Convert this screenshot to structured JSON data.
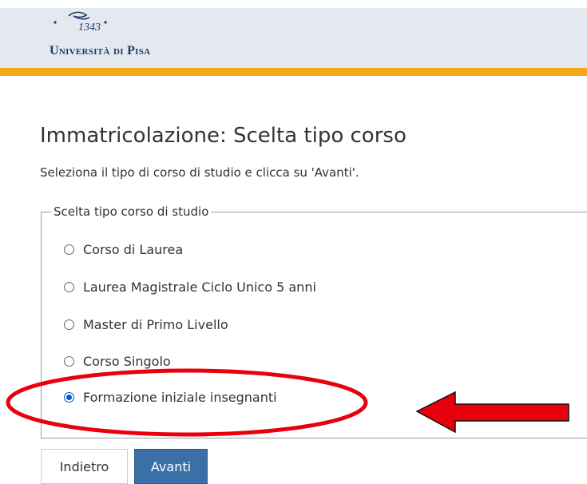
{
  "header": {
    "logo_year": "1343",
    "logo_text": "Università di Pisa",
    "bar_color": "#f6a919",
    "background_color": "#e3e9ee"
  },
  "main": {
    "title": "Immatricolazione: Scelta tipo corso",
    "instruction": "Seleziona il tipo di corso di studio e clicca su 'Avanti'.",
    "fieldset_legend": "Scelta tipo corso di studio",
    "options": [
      {
        "label": "Corso di Laurea",
        "checked": false
      },
      {
        "label": "Laurea Magistrale Ciclo Unico 5 anni",
        "checked": false
      },
      {
        "label": "Master di Primo Livello",
        "checked": false
      },
      {
        "label": "Corso Singolo",
        "checked": false
      },
      {
        "label": "Formazione iniziale insegnanti",
        "checked": true
      }
    ]
  },
  "buttons": {
    "back_label": "Indietro",
    "next_label": "Avanti"
  },
  "annotations": {
    "highlight_color": "#e8000d",
    "arrow_color": "#e8000d"
  }
}
